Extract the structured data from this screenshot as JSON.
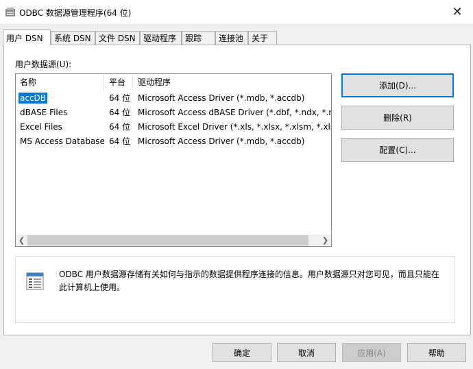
{
  "window": {
    "title": "ODBC 数据源管理程序(64 位)",
    "close_glyph": "✕"
  },
  "tabs": [
    "用户 DSN",
    "系统 DSN",
    "文件 DSN",
    "驱动程序",
    "跟踪",
    "连接池",
    "关于"
  ],
  "active_tab": "用户 DSN",
  "user_dsn": {
    "section_label": "用户数据源(U):",
    "columns": [
      "名称",
      "平台",
      "驱动程序"
    ],
    "rows": [
      {
        "name": "accDB",
        "platform": "64 位",
        "driver": "Microsoft Access Driver (*.mdb, *.accdb)",
        "selected": true
      },
      {
        "name": "dBASE Files",
        "platform": "64 位",
        "driver": "Microsoft Access dBASE Driver (*.dbf, *.ndx, *.mdx)"
      },
      {
        "name": "Excel Files",
        "platform": "64 位",
        "driver": "Microsoft Excel Driver (*.xls, *.xlsx, *.xlsm, *.xlsb)"
      },
      {
        "name": "MS Access Database",
        "platform": "64 位",
        "driver": "Microsoft Access Driver (*.mdb, *.accdb)"
      }
    ],
    "buttons": {
      "add": "添加(D)...",
      "remove": "删除(R)",
      "configure": "配置(C)..."
    },
    "info_text": "ODBC 用户数据源存储有关如何与指示的数据提供程序连接的信息。用户数据源只对您可见，而且只能在此计算机上使用。"
  },
  "dialog_buttons": {
    "ok": "确定",
    "cancel": "取消",
    "apply": "应用(A)",
    "help": "帮助"
  },
  "colors": {
    "selection": "#0078d7",
    "default_button_border": "#0078d7"
  },
  "icons": [
    "odbc-app-icon",
    "close-icon",
    "scroll-left-icon",
    "scroll-right-icon",
    "data-source-info-icon"
  ]
}
